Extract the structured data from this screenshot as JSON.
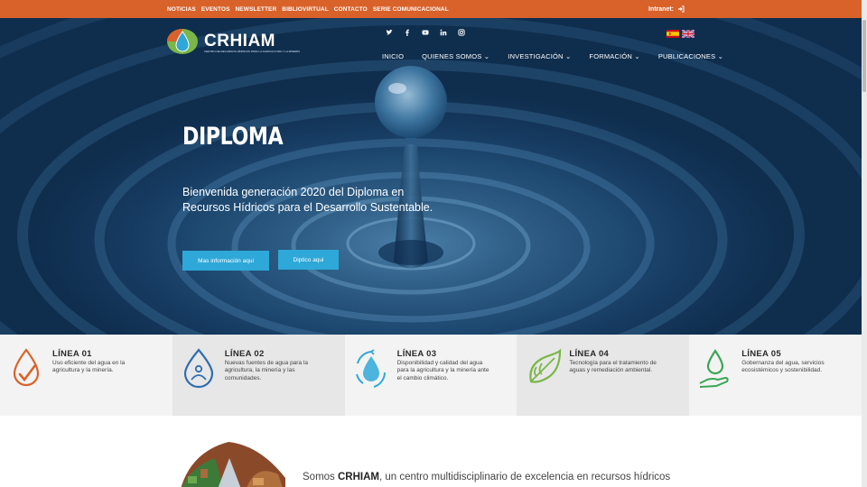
{
  "topbar": {
    "links": [
      "NOTICIAS",
      "EVENTOS",
      "NEWSLETTER",
      "BIBLIOVIRTUAL",
      "CONTACTO",
      "SERIE COMUNICACIONAL"
    ],
    "intranet_label": "Intranet:",
    "color": "#d9622b"
  },
  "header": {
    "logo_text": "CRHIAM",
    "logo_subtitle": "CENTRO DE RECURSOS HÍDRICOS PARA LA AGRICULTURA Y LA MINERÍA",
    "social_icons": [
      "twitter-icon",
      "facebook-icon",
      "youtube-icon",
      "linkedin-icon",
      "instagram-icon"
    ],
    "languages": [
      "es",
      "en"
    ],
    "nav": [
      "INICIO",
      "QUIENES SOMOS",
      "INVESTIGACIÓN",
      "FORMACIÓN",
      "PUBLICACIONES"
    ]
  },
  "hero": {
    "title": "DIPLOMA",
    "text": "Bienvenida generación 2020 del Diploma en Recursos Hídricos para el Desarrollo Sustentable.",
    "button1": "Mas información aqui",
    "button2": "Diptico aqui",
    "button_color": "#2ea8d8"
  },
  "lines": [
    {
      "title": "LÍNEA 01",
      "desc": "Uso eficiente del agua en la agricultura y la minería.",
      "icon": "drop-check-icon",
      "color": "#d9622b"
    },
    {
      "title": "LÍNEA 02",
      "desc": "Nuevas fuentes de agua para la agricultura, la minería y las comunidades.",
      "icon": "drop-people-icon",
      "color": "#2f6db0"
    },
    {
      "title": "LÍNEA 03",
      "desc": "Disponibilidad y calidad del agua para la agricultura y la minería ante el cambio climático.",
      "icon": "drop-cycle-icon",
      "color": "#2ea8d8"
    },
    {
      "title": "LÍNEA 04",
      "desc": "Tecnología para el tratamiento de aguas y remediación ambiental.",
      "icon": "leaf-drop-icon",
      "color": "#7ab648"
    },
    {
      "title": "LÍNEA 05",
      "desc": "Gobernanza del agua, servicios ecosistémicos y sostenibilidad.",
      "icon": "hand-drop-icon",
      "color": "#3aa655"
    }
  ],
  "intro": {
    "prefix": "Somos ",
    "name": "CRHIAM",
    "suffix": ", un centro multidisciplinario de excelencia en recursos hídricos"
  }
}
